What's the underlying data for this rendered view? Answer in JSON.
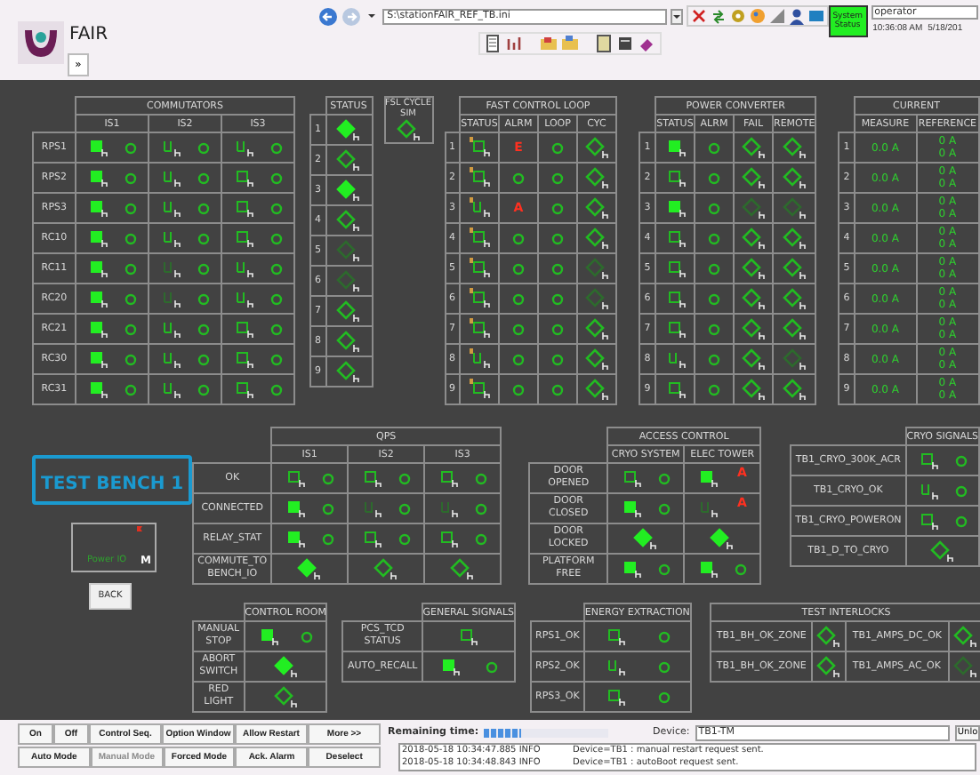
{
  "header": {
    "app_name": "FAIR",
    "expand_button": "»",
    "address": "S:\\stationFAIR_REF_TB.ini",
    "system_status": "System Status",
    "operator": "operator",
    "time": "10:36:08 AM",
    "date": "5/18/201"
  },
  "commutators": {
    "title": "COMMUTATORS",
    "columns": [
      "IS1",
      "IS2",
      "IS3"
    ],
    "rows": [
      {
        "label": "RPS1",
        "cells": [
          [
            {
              "kind": "square",
              "on": true,
              "dim": false
            },
            {
              "kind": "circle"
            }
          ],
          [
            {
              "kind": "bars",
              "on": false,
              "dim": false
            },
            {
              "kind": "circle"
            }
          ],
          [
            {
              "kind": "bars",
              "on": false,
              "dim": false
            },
            {
              "kind": "circle"
            }
          ]
        ]
      },
      {
        "label": "RPS2",
        "cells": [
          [
            {
              "kind": "square",
              "on": true,
              "dim": false
            },
            {
              "kind": "circle"
            }
          ],
          [
            {
              "kind": "bars",
              "on": false,
              "dim": false
            },
            {
              "kind": "circle"
            }
          ],
          [
            {
              "kind": "square",
              "on": false,
              "dim": false
            },
            {
              "kind": "circle"
            }
          ]
        ]
      },
      {
        "label": "RPS3",
        "cells": [
          [
            {
              "kind": "square",
              "on": true,
              "dim": false
            },
            {
              "kind": "circle"
            }
          ],
          [
            {
              "kind": "bars",
              "on": false,
              "dim": false
            },
            {
              "kind": "circle"
            }
          ],
          [
            {
              "kind": "square",
              "on": false,
              "dim": false
            },
            {
              "kind": "circle"
            }
          ]
        ]
      },
      {
        "label": "RC10",
        "cells": [
          [
            {
              "kind": "square",
              "on": true,
              "dim": false
            },
            {
              "kind": "circle"
            }
          ],
          [
            {
              "kind": "bars",
              "on": false,
              "dim": false
            },
            {
              "kind": "circle"
            }
          ],
          [
            {
              "kind": "square",
              "on": false,
              "dim": false
            },
            {
              "kind": "circle"
            }
          ]
        ]
      },
      {
        "label": "RC11",
        "cells": [
          [
            {
              "kind": "square",
              "on": true,
              "dim": false
            },
            {
              "kind": "circle"
            }
          ],
          [
            {
              "kind": "bars",
              "on": false,
              "dim": true
            },
            {
              "kind": "circle"
            }
          ],
          [
            {
              "kind": "bars",
              "on": false,
              "dim": false
            },
            {
              "kind": "circle"
            }
          ]
        ]
      },
      {
        "label": "RC20",
        "cells": [
          [
            {
              "kind": "square",
              "on": true,
              "dim": false
            },
            {
              "kind": "circle"
            }
          ],
          [
            {
              "kind": "bars",
              "on": false,
              "dim": true
            },
            {
              "kind": "circle"
            }
          ],
          [
            {
              "kind": "bars",
              "on": false,
              "dim": false
            },
            {
              "kind": "circle"
            }
          ]
        ]
      },
      {
        "label": "RC21",
        "cells": [
          [
            {
              "kind": "square",
              "on": true,
              "dim": false
            },
            {
              "kind": "circle"
            }
          ],
          [
            {
              "kind": "bars",
              "on": false,
              "dim": false
            },
            {
              "kind": "circle"
            }
          ],
          [
            {
              "kind": "square",
              "on": false,
              "dim": false
            },
            {
              "kind": "circle"
            }
          ]
        ]
      },
      {
        "label": "RC30",
        "cells": [
          [
            {
              "kind": "square",
              "on": true,
              "dim": false
            },
            {
              "kind": "circle"
            }
          ],
          [
            {
              "kind": "bars",
              "on": false,
              "dim": false
            },
            {
              "kind": "circle"
            }
          ],
          [
            {
              "kind": "square",
              "on": false,
              "dim": false
            },
            {
              "kind": "circle"
            }
          ]
        ]
      },
      {
        "label": "RC31",
        "cells": [
          [
            {
              "kind": "square",
              "on": true,
              "dim": false
            },
            {
              "kind": "circle"
            }
          ],
          [
            {
              "kind": "bars",
              "on": false,
              "dim": false
            },
            {
              "kind": "circle"
            }
          ],
          [
            {
              "kind": "square",
              "on": false,
              "dim": false
            },
            {
              "kind": "circle"
            }
          ]
        ]
      }
    ]
  },
  "status": {
    "title": "STATUS",
    "rows": [
      {
        "label": "1",
        "cells": [
          [
            {
              "kind": "diamond",
              "on": true,
              "dim": false
            }
          ]
        ]
      },
      {
        "label": "2",
        "cells": [
          [
            {
              "kind": "diamond",
              "on": false,
              "dim": false
            }
          ]
        ]
      },
      {
        "label": "3",
        "cells": [
          [
            {
              "kind": "diamond",
              "on": true,
              "dim": false
            }
          ]
        ]
      },
      {
        "label": "4",
        "cells": [
          [
            {
              "kind": "diamond",
              "on": false,
              "dim": false
            }
          ]
        ]
      },
      {
        "label": "5",
        "cells": [
          [
            {
              "kind": "diamond",
              "on": false,
              "dim": true
            }
          ]
        ]
      },
      {
        "label": "6",
        "cells": [
          [
            {
              "kind": "diamond",
              "on": false,
              "dim": true
            }
          ]
        ]
      },
      {
        "label": "7",
        "cells": [
          [
            {
              "kind": "diamond",
              "on": false,
              "dim": false
            }
          ]
        ]
      },
      {
        "label": "8",
        "cells": [
          [
            {
              "kind": "diamond",
              "on": false,
              "dim": false
            }
          ]
        ]
      },
      {
        "label": "9",
        "cells": [
          [
            {
              "kind": "diamond",
              "on": false,
              "dim": false
            }
          ]
        ]
      }
    ]
  },
  "fsl": {
    "label": "FSL CYCLE SIM",
    "indicator": {
      "kind": "diamond",
      "on": false,
      "dim": false
    }
  },
  "fast_control_loop": {
    "title": "FAST CONTROL LOOP",
    "columns": [
      "STATUS",
      "ALRM",
      "LOOP",
      "CYC"
    ],
    "rows": [
      {
        "label": "1",
        "cells": [
          [
            {
              "kind": "square",
              "on": false,
              "dim": false,
              "flag": true
            }
          ],
          [
            {
              "kind": "alarm",
              "text": "E"
            }
          ],
          [
            {
              "kind": "circle"
            }
          ],
          [
            {
              "kind": "diamond",
              "on": false,
              "dim": false
            }
          ]
        ]
      },
      {
        "label": "2",
        "cells": [
          [
            {
              "kind": "square",
              "on": false,
              "dim": false,
              "flag": true
            }
          ],
          [
            {
              "kind": "circle"
            }
          ],
          [
            {
              "kind": "circle"
            }
          ],
          [
            {
              "kind": "diamond",
              "on": false,
              "dim": false
            }
          ]
        ]
      },
      {
        "label": "3",
        "cells": [
          [
            {
              "kind": "bars",
              "on": false,
              "dim": false,
              "flag": true
            }
          ],
          [
            {
              "kind": "alarm",
              "text": "A"
            }
          ],
          [
            {
              "kind": "circle"
            }
          ],
          [
            {
              "kind": "diamond",
              "on": false,
              "dim": false
            }
          ]
        ]
      },
      {
        "label": "4",
        "cells": [
          [
            {
              "kind": "square",
              "on": false,
              "dim": false,
              "flag": true
            }
          ],
          [
            {
              "kind": "circle"
            }
          ],
          [
            {
              "kind": "circle"
            }
          ],
          [
            {
              "kind": "diamond",
              "on": false,
              "dim": false
            }
          ]
        ]
      },
      {
        "label": "5",
        "cells": [
          [
            {
              "kind": "square",
              "on": false,
              "dim": false,
              "flag": true
            }
          ],
          [
            {
              "kind": "circle"
            }
          ],
          [
            {
              "kind": "circle"
            }
          ],
          [
            {
              "kind": "diamond",
              "on": false,
              "dim": true
            }
          ]
        ]
      },
      {
        "label": "6",
        "cells": [
          [
            {
              "kind": "square",
              "on": false,
              "dim": false,
              "flag": true
            }
          ],
          [
            {
              "kind": "circle"
            }
          ],
          [
            {
              "kind": "circle"
            }
          ],
          [
            {
              "kind": "diamond",
              "on": false,
              "dim": true
            }
          ]
        ]
      },
      {
        "label": "7",
        "cells": [
          [
            {
              "kind": "square",
              "on": false,
              "dim": false,
              "flag": true
            }
          ],
          [
            {
              "kind": "circle"
            }
          ],
          [
            {
              "kind": "circle"
            }
          ],
          [
            {
              "kind": "diamond",
              "on": false,
              "dim": false
            }
          ]
        ]
      },
      {
        "label": "8",
        "cells": [
          [
            {
              "kind": "bars",
              "on": false,
              "dim": false,
              "flag": true
            }
          ],
          [
            {
              "kind": "circle"
            }
          ],
          [
            {
              "kind": "circle"
            }
          ],
          [
            {
              "kind": "diamond",
              "on": false,
              "dim": false
            }
          ]
        ]
      },
      {
        "label": "9",
        "cells": [
          [
            {
              "kind": "square",
              "on": false,
              "dim": false,
              "flag": true
            }
          ],
          [
            {
              "kind": "circle"
            }
          ],
          [
            {
              "kind": "circle"
            }
          ],
          [
            {
              "kind": "diamond",
              "on": false,
              "dim": false
            }
          ]
        ]
      }
    ]
  },
  "power_converter": {
    "title": "POWER CONVERTER",
    "columns": [
      "STATUS",
      "ALRM",
      "FAIL",
      "REMOTE"
    ],
    "rows": [
      {
        "label": "1",
        "cells": [
          [
            {
              "kind": "square",
              "on": true,
              "dim": false
            }
          ],
          [
            {
              "kind": "circle"
            }
          ],
          [
            {
              "kind": "diamond",
              "on": false,
              "dim": false
            }
          ],
          [
            {
              "kind": "diamond",
              "on": false,
              "dim": false
            }
          ]
        ]
      },
      {
        "label": "2",
        "cells": [
          [
            {
              "kind": "square",
              "on": false,
              "dim": false
            }
          ],
          [
            {
              "kind": "circle"
            }
          ],
          [
            {
              "kind": "diamond",
              "on": false,
              "dim": false
            }
          ],
          [
            {
              "kind": "diamond",
              "on": false,
              "dim": false
            }
          ]
        ]
      },
      {
        "label": "3",
        "cells": [
          [
            {
              "kind": "square",
              "on": true,
              "dim": false
            }
          ],
          [
            {
              "kind": "circle"
            }
          ],
          [
            {
              "kind": "diamond",
              "on": false,
              "dim": true
            }
          ],
          [
            {
              "kind": "diamond",
              "on": false,
              "dim": true
            }
          ]
        ]
      },
      {
        "label": "4",
        "cells": [
          [
            {
              "kind": "square",
              "on": false,
              "dim": false
            }
          ],
          [
            {
              "kind": "circle"
            }
          ],
          [
            {
              "kind": "diamond",
              "on": false,
              "dim": false
            }
          ],
          [
            {
              "kind": "diamond",
              "on": false,
              "dim": false
            }
          ]
        ]
      },
      {
        "label": "5",
        "cells": [
          [
            {
              "kind": "square",
              "on": false,
              "dim": false
            }
          ],
          [
            {
              "kind": "circle"
            }
          ],
          [
            {
              "kind": "diamond",
              "on": false,
              "dim": false
            }
          ],
          [
            {
              "kind": "diamond",
              "on": false,
              "dim": false
            }
          ]
        ]
      },
      {
        "label": "6",
        "cells": [
          [
            {
              "kind": "square",
              "on": false,
              "dim": false
            }
          ],
          [
            {
              "kind": "circle"
            }
          ],
          [
            {
              "kind": "diamond",
              "on": false,
              "dim": false
            }
          ],
          [
            {
              "kind": "diamond",
              "on": false,
              "dim": false
            }
          ]
        ]
      },
      {
        "label": "7",
        "cells": [
          [
            {
              "kind": "square",
              "on": false,
              "dim": false
            }
          ],
          [
            {
              "kind": "circle"
            }
          ],
          [
            {
              "kind": "diamond",
              "on": false,
              "dim": false
            }
          ],
          [
            {
              "kind": "diamond",
              "on": false,
              "dim": false
            }
          ]
        ]
      },
      {
        "label": "8",
        "cells": [
          [
            {
              "kind": "bars",
              "on": false,
              "dim": false
            }
          ],
          [
            {
              "kind": "circle"
            }
          ],
          [
            {
              "kind": "diamond",
              "on": false,
              "dim": false
            }
          ],
          [
            {
              "kind": "diamond",
              "on": false,
              "dim": true
            }
          ]
        ]
      },
      {
        "label": "9",
        "cells": [
          [
            {
              "kind": "square",
              "on": false,
              "dim": false
            }
          ],
          [
            {
              "kind": "circle"
            }
          ],
          [
            {
              "kind": "diamond",
              "on": false,
              "dim": false
            }
          ],
          [
            {
              "kind": "diamond",
              "on": false,
              "dim": false
            }
          ]
        ]
      }
    ]
  },
  "current": {
    "title": "CURRENT",
    "columns": [
      "MEASURE",
      "REFERENCE"
    ],
    "rows": [
      {
        "label": "1",
        "cells": [
          [
            {
              "kind": "reading",
              "text": "0.0 A"
            }
          ],
          [
            {
              "kind": "reading",
              "text": "0 A"
            },
            {
              "kind": "reading",
              "text": "0 A"
            }
          ]
        ]
      },
      {
        "label": "2",
        "cells": [
          [
            {
              "kind": "reading",
              "text": "0.0 A"
            }
          ],
          [
            {
              "kind": "reading",
              "text": "0 A"
            },
            {
              "kind": "reading",
              "text": "0 A"
            }
          ]
        ]
      },
      {
        "label": "3",
        "cells": [
          [
            {
              "kind": "reading",
              "text": "0.0 A"
            }
          ],
          [
            {
              "kind": "reading",
              "text": "0 A"
            },
            {
              "kind": "reading",
              "text": "0 A"
            }
          ]
        ]
      },
      {
        "label": "4",
        "cells": [
          [
            {
              "kind": "reading",
              "text": "0.0 A"
            }
          ],
          [
            {
              "kind": "reading",
              "text": "0 A"
            },
            {
              "kind": "reading",
              "text": "0 A"
            }
          ]
        ]
      },
      {
        "label": "5",
        "cells": [
          [
            {
              "kind": "reading",
              "text": "0.0 A"
            }
          ],
          [
            {
              "kind": "reading",
              "text": "0 A"
            },
            {
              "kind": "reading",
              "text": "0 A"
            }
          ]
        ]
      },
      {
        "label": "6",
        "cells": [
          [
            {
              "kind": "reading",
              "text": "0.0 A"
            }
          ],
          [
            {
              "kind": "reading",
              "text": "0 A"
            },
            {
              "kind": "reading",
              "text": "0 A"
            }
          ]
        ]
      },
      {
        "label": "7",
        "cells": [
          [
            {
              "kind": "reading",
              "text": "0.0 A"
            }
          ],
          [
            {
              "kind": "reading",
              "text": "0 A"
            },
            {
              "kind": "reading",
              "text": "0 A"
            }
          ]
        ]
      },
      {
        "label": "8",
        "cells": [
          [
            {
              "kind": "reading",
              "text": "0.0 A"
            }
          ],
          [
            {
              "kind": "reading",
              "text": "0 A"
            },
            {
              "kind": "reading",
              "text": "0 A"
            }
          ]
        ]
      },
      {
        "label": "9",
        "cells": [
          [
            {
              "kind": "reading",
              "text": "0.0 A"
            }
          ],
          [
            {
              "kind": "reading",
              "text": "0 A"
            },
            {
              "kind": "reading",
              "text": "0 A"
            }
          ]
        ]
      }
    ]
  },
  "test_bench": {
    "title": "TEST BENCH 1",
    "power_label": "Power IO",
    "mode": "M",
    "back_button": "BACK"
  },
  "qps": {
    "title": "QPS",
    "columns": [
      "IS1",
      "IS2",
      "IS3"
    ],
    "rows": [
      {
        "label": "OK",
        "cells": [
          [
            {
              "kind": "square",
              "on": false,
              "dim": false
            },
            {
              "kind": "circle"
            }
          ],
          [
            {
              "kind": "square",
              "on": false,
              "dim": false
            },
            {
              "kind": "circle"
            }
          ],
          [
            {
              "kind": "square",
              "on": false,
              "dim": false
            },
            {
              "kind": "circle"
            }
          ]
        ]
      },
      {
        "label": "CONNECTED",
        "cells": [
          [
            {
              "kind": "square",
              "on": true,
              "dim": false
            },
            {
              "kind": "circle"
            }
          ],
          [
            {
              "kind": "bars",
              "on": false,
              "dim": true
            },
            {
              "kind": "circle"
            }
          ],
          [
            {
              "kind": "bars",
              "on": false,
              "dim": true
            },
            {
              "kind": "circle"
            }
          ]
        ]
      },
      {
        "label": "RELAY_STAT",
        "cells": [
          [
            {
              "kind": "square",
              "on": true,
              "dim": false
            },
            {
              "kind": "circle"
            }
          ],
          [
            {
              "kind": "square",
              "on": false,
              "dim": false
            },
            {
              "kind": "circle"
            }
          ],
          [
            {
              "kind": "square",
              "on": false,
              "dim": false
            },
            {
              "kind": "circle"
            }
          ]
        ]
      },
      {
        "label": "COMMUTE_TO BENCH_IO",
        "cells": [
          [
            {
              "kind": "diamond",
              "on": true,
              "dim": false
            }
          ],
          [
            {
              "kind": "diamond",
              "on": false,
              "dim": false
            }
          ],
          [
            {
              "kind": "diamond",
              "on": false,
              "dim": false
            }
          ]
        ]
      }
    ]
  },
  "access_control": {
    "title": "ACCESS CONTROL",
    "columns": [
      "CRYO SYSTEM",
      "ELEC TOWER"
    ],
    "rows": [
      {
        "label": "DOOR OPENED",
        "cells": [
          [
            {
              "kind": "square",
              "on": false,
              "dim": false
            },
            {
              "kind": "circle"
            }
          ],
          [
            {
              "kind": "square",
              "on": true,
              "dim": false
            },
            {
              "kind": "alarm",
              "text": "A"
            }
          ]
        ]
      },
      {
        "label": "DOOR CLOSED",
        "cells": [
          [
            {
              "kind": "square",
              "on": true,
              "dim": false
            },
            {
              "kind": "circle"
            }
          ],
          [
            {
              "kind": "bars",
              "on": false,
              "dim": true
            },
            {
              "kind": "alarm",
              "text": "A"
            }
          ]
        ]
      },
      {
        "label": "DOOR LOCKED",
        "cells": [
          [
            {
              "kind": "diamond",
              "on": true,
              "dim": false
            }
          ],
          [
            {
              "kind": "diamond",
              "on": true,
              "dim": false
            }
          ]
        ]
      },
      {
        "label": "PLATFORM FREE",
        "cells": [
          [
            {
              "kind": "square",
              "on": true,
              "dim": false
            },
            {
              "kind": "circle"
            }
          ],
          [
            {
              "kind": "square",
              "on": true,
              "dim": false
            },
            {
              "kind": "circle"
            }
          ]
        ]
      }
    ]
  },
  "cryo_signals": {
    "title": "CRYO SIGNALS",
    "rows": [
      {
        "label": "TB1_CRYO_300K_ACR",
        "cells": [
          [
            {
              "kind": "square",
              "on": false,
              "dim": false
            },
            {
              "kind": "circle"
            }
          ]
        ]
      },
      {
        "label": "TB1_CRYO_OK",
        "cells": [
          [
            {
              "kind": "bars",
              "on": false,
              "dim": false
            },
            {
              "kind": "circle"
            }
          ]
        ]
      },
      {
        "label": "TB1_CRYO_POWERON",
        "cells": [
          [
            {
              "kind": "square",
              "on": false,
              "dim": false
            },
            {
              "kind": "circle"
            }
          ]
        ]
      },
      {
        "label": "TB1_D_TO_CRYO",
        "cells": [
          [
            {
              "kind": "diamond",
              "on": false,
              "dim": false
            }
          ]
        ]
      }
    ]
  },
  "control_room": {
    "title": "CONTROL ROOM",
    "rows": [
      {
        "label": "MANUAL STOP",
        "cells": [
          [
            {
              "kind": "square",
              "on": true,
              "dim": false
            },
            {
              "kind": "circle"
            }
          ]
        ]
      },
      {
        "label": "ABORT SWITCH",
        "cells": [
          [
            {
              "kind": "diamond",
              "on": true,
              "dim": false
            }
          ]
        ]
      },
      {
        "label": "RED LIGHT",
        "cells": [
          [
            {
              "kind": "diamond",
              "on": false,
              "dim": false
            }
          ]
        ]
      }
    ]
  },
  "general_signals": {
    "title": "GENERAL SIGNALS",
    "rows": [
      {
        "label": "PCS_TCD STATUS",
        "cells": [
          [
            {
              "kind": "square",
              "on": false,
              "dim": false
            }
          ]
        ]
      },
      {
        "label": "AUTO_RECALL",
        "cells": [
          [
            {
              "kind": "square",
              "on": true,
              "dim": false
            },
            {
              "kind": "circle"
            }
          ]
        ]
      }
    ]
  },
  "energy_extraction": {
    "title": "ENERGY EXTRACTION",
    "rows": [
      {
        "label": "RPS1_OK",
        "cells": [
          [
            {
              "kind": "square",
              "on": false,
              "dim": false
            },
            {
              "kind": "circle"
            }
          ]
        ]
      },
      {
        "label": "RPS2_OK",
        "cells": [
          [
            {
              "kind": "bars",
              "on": false,
              "dim": false
            },
            {
              "kind": "circle"
            }
          ]
        ]
      },
      {
        "label": "RPS3_OK",
        "cells": [
          [
            {
              "kind": "square",
              "on": false,
              "dim": false
            },
            {
              "kind": "circle"
            }
          ]
        ]
      }
    ]
  },
  "test_interlocks": {
    "title": "TEST INTERLOCKS",
    "rows": [
      {
        "pairs": [
          {
            "label": "TB1_BH_OK_ZONE",
            "cell": [
              {
                "kind": "diamond",
                "on": false,
                "dim": false
              }
            ]
          },
          {
            "label": "TB1_AMPS_DC_OK",
            "cell": [
              {
                "kind": "diamond",
                "on": false,
                "dim": false
              }
            ]
          }
        ]
      },
      {
        "pairs": [
          {
            "label": "TB1_BH_OK_ZONE",
            "cell": [
              {
                "kind": "diamond",
                "on": false,
                "dim": false
              }
            ]
          },
          {
            "label": "TB1_AMPS_AC_OK",
            "cell": [
              {
                "kind": "diamond",
                "on": false,
                "dim": true
              }
            ]
          }
        ]
      }
    ]
  },
  "buttons_top": [
    {
      "label": "On",
      "disabled": false
    },
    {
      "label": "Off",
      "disabled": false
    },
    {
      "label": "Control Seq.",
      "disabled": false
    },
    {
      "label": "Option Window",
      "disabled": false
    },
    {
      "label": "Allow Restart",
      "disabled": false
    },
    {
      "label": "More >>",
      "disabled": false
    }
  ],
  "buttons_bottom": [
    {
      "label": "Auto Mode",
      "disabled": false
    },
    {
      "label": "Manual Mode",
      "disabled": true
    },
    {
      "label": "Forced Mode",
      "disabled": false
    },
    {
      "label": "Ack. Alarm",
      "disabled": false
    },
    {
      "label": "Deselect",
      "disabled": false
    }
  ],
  "remaining": {
    "label": "Remaining time:",
    "level": 0.3
  },
  "device": {
    "label": "Device:",
    "value": "TB1-TM",
    "button": "Unlo"
  },
  "log": [
    {
      "time": "2018-05-18 10:34:47.885 INFO",
      "message": "Device=TB1 : manual restart request sent."
    },
    {
      "time": "2018-05-18 10:34:48.843 INFO",
      "message": "Device=TB1 : autoBoot request sent."
    }
  ]
}
